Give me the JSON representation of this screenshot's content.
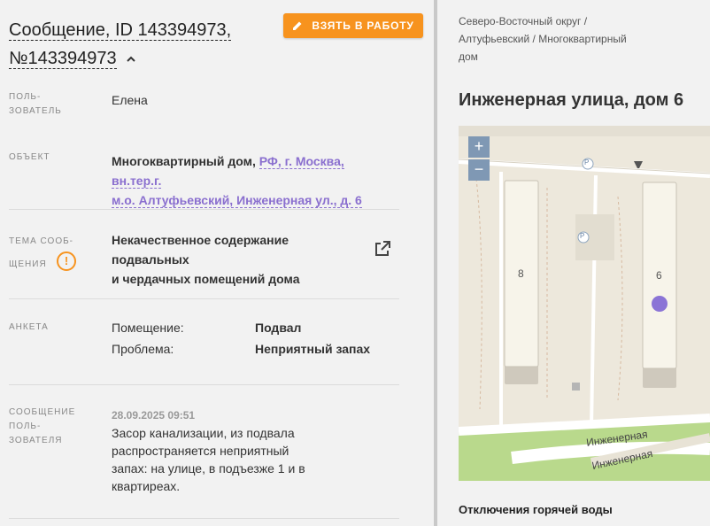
{
  "header": {
    "title_line1": "Сообщение, ID 143394973,",
    "title_line2": "№143394973",
    "take_button": "ВЗЯТЬ В РАБОТУ"
  },
  "user": {
    "label_line1": "ПОЛЬ-",
    "label_line2": "ЗОВАТЕЛЬ",
    "value": "Елена"
  },
  "object": {
    "label": "ОБЪЕКТ",
    "type": "Многоквартирный дом,",
    "address_line1": "РФ, г. Москва, вн.тер.г.",
    "address_line2": "м.о. Алтуфьевский, Инженерная ул., д. 6"
  },
  "topic": {
    "label_line1": "ТЕМА СООБ-",
    "label_line2": "ЩЕНИЯ",
    "line1": "Некачественное содержание подвальных",
    "line2": "и чердачных помещений дома"
  },
  "survey": {
    "label": "АНКЕТА",
    "rows": [
      {
        "key": "Помещение:",
        "value": "Подвал"
      },
      {
        "key": "Проблема:",
        "value": "Неприятный запах"
      }
    ]
  },
  "message": {
    "label_line1": "СООБЩЕНИЕ",
    "label_line2": "ПОЛЬ-",
    "label_line3": "ЗОВАТЕЛЯ",
    "timestamp": "28.09.2025 09:51",
    "lines": [
      "Засор канализации, из подвала",
      "распространяется неприятный",
      "запах: на улице, в подъезже 1 и в",
      "квартиреах."
    ]
  },
  "right": {
    "crumb_line1": "Северо-Восточный округ /",
    "crumb_line2": "Алтуфьевский / Многоквартирный",
    "crumb_line3": "дом",
    "address": "Инженерная улица, дом 6",
    "outage": "Отключения горячей воды"
  },
  "map": {
    "zoom_in": "+",
    "zoom_out": "−",
    "building_left": "8",
    "building_right": "6",
    "parking1": "P",
    "parking2": "P",
    "street1": "Инженерная",
    "street2": "Инженерная",
    "colors": {
      "marker": "#8b74d6",
      "park": "#b9d98c",
      "road": "#ffffff",
      "building": "#f7f4ea"
    }
  },
  "colors": {
    "accent": "#f7931e",
    "link": "#8a6fcf"
  }
}
